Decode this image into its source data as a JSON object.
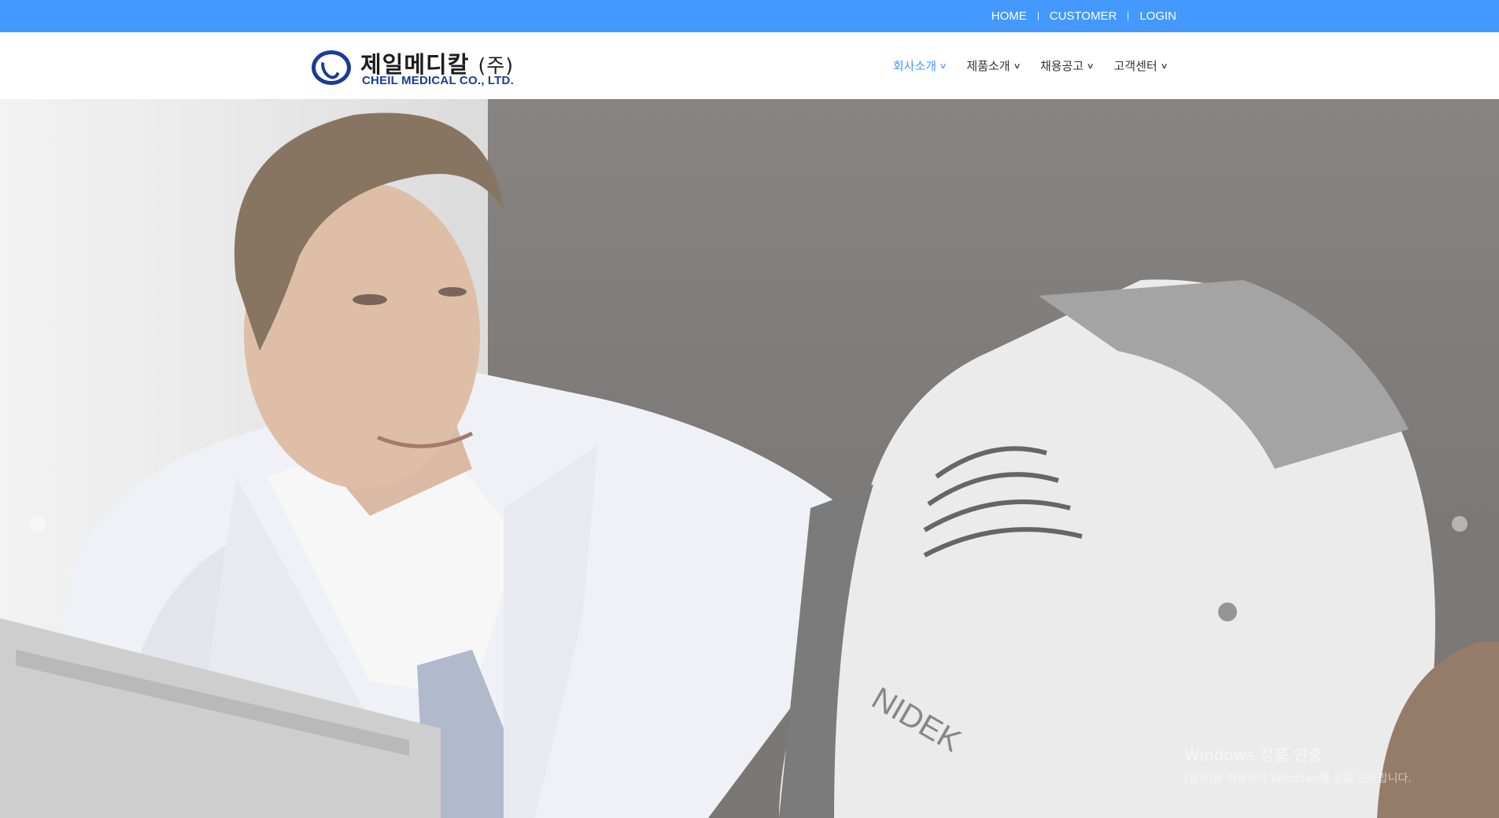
{
  "topbar": {
    "links": [
      "HOME",
      "CUSTOMER",
      "LOGIN"
    ],
    "background": "#4499ff"
  },
  "logo": {
    "korean": "제일메디칼",
    "corp": "(주)",
    "english": "CHEIL MEDICAL CO., LTD.",
    "color": "#1a3b9a"
  },
  "nav": {
    "items": [
      {
        "label": "회사소개",
        "active": true
      },
      {
        "label": "제품소개",
        "active": false
      },
      {
        "label": "채용공고",
        "active": false
      },
      {
        "label": "고객센터",
        "active": false
      }
    ],
    "active_color": "#4499ff"
  },
  "hero": {
    "device_brand": "NIDEK"
  },
  "watermark": {
    "title": "Windows 정품 인증",
    "subtitle": "[설정]을 이용하여 Windows를 정품 인증합니다."
  }
}
